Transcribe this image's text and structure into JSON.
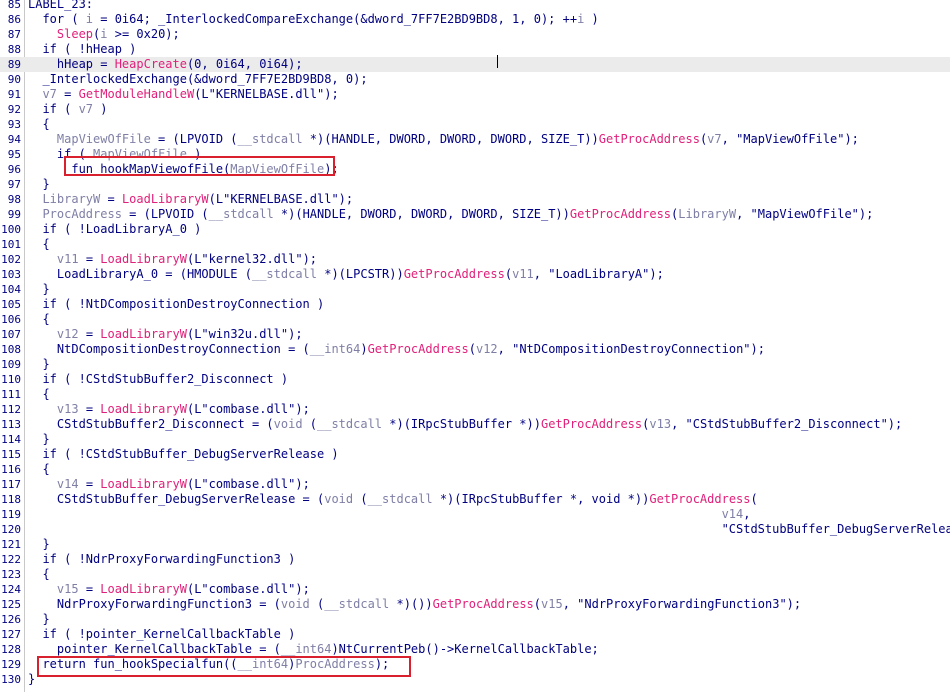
{
  "editor": {
    "lines": [
      {
        "n": "85",
        "parts": [
          {
            "t": "LABEL_23:"
          }
        ]
      },
      {
        "n": "86",
        "parts": [
          {
            "t": "  for ( "
          },
          {
            "t": "i",
            "c": "gr"
          },
          {
            "t": " = 0i64; _InterlockedCompareExchange(&dword_7FF7E2BD9BD8, 1, 0); ++"
          },
          {
            "t": "i",
            "c": "gr"
          },
          {
            "t": " )"
          }
        ]
      },
      {
        "n": "87",
        "parts": [
          {
            "t": "    "
          },
          {
            "t": "Sleep",
            "c": "pk"
          },
          {
            "t": "("
          },
          {
            "t": "i",
            "c": "gr"
          },
          {
            "t": " >= 0x20);"
          }
        ]
      },
      {
        "n": "88",
        "parts": [
          {
            "t": "  if ( !hHeap )"
          }
        ]
      },
      {
        "n": "89",
        "hl": true,
        "parts": [
          {
            "t": "    hHeap = "
          },
          {
            "t": "HeapCreate",
            "c": "pk"
          },
          {
            "t": "(0, 0i64, 0i64);"
          }
        ]
      },
      {
        "n": "90",
        "parts": [
          {
            "t": "  _InterlockedExchange(&dword_7FF7E2BD9BD8, 0);"
          }
        ]
      },
      {
        "n": "91",
        "parts": [
          {
            "t": "  "
          },
          {
            "t": "v7",
            "c": "gr"
          },
          {
            "t": " = "
          },
          {
            "t": "GetModuleHandleW",
            "c": "pk"
          },
          {
            "t": "(L\"KERNELBASE.dll\");"
          }
        ]
      },
      {
        "n": "92",
        "parts": [
          {
            "t": "  if ( "
          },
          {
            "t": "v7",
            "c": "gr"
          },
          {
            "t": " )"
          }
        ]
      },
      {
        "n": "93",
        "parts": [
          {
            "t": "  {"
          }
        ]
      },
      {
        "n": "94",
        "parts": [
          {
            "t": "    "
          },
          {
            "t": "MapViewOfFile",
            "c": "gr"
          },
          {
            "t": " = (LPVOID ("
          },
          {
            "t": "__stdcall",
            "c": "gr"
          },
          {
            "t": " *)(HANDLE, DWORD, DWORD, DWORD, SIZE_T))"
          },
          {
            "t": "GetProcAddress",
            "c": "pk"
          },
          {
            "t": "("
          },
          {
            "t": "v7",
            "c": "gr"
          },
          {
            "t": ", \"MapViewOfFile\");"
          }
        ]
      },
      {
        "n": "95",
        "parts": [
          {
            "t": "    if ( "
          },
          {
            "t": "MapViewOfFile",
            "c": "gr"
          },
          {
            "t": " )"
          }
        ]
      },
      {
        "n": "96",
        "parts": [
          {
            "t": "      fun_hookMapViewofFile("
          },
          {
            "t": "MapViewOfFile",
            "c": "gr"
          },
          {
            "t": ");"
          }
        ]
      },
      {
        "n": "97",
        "parts": [
          {
            "t": "  }"
          }
        ]
      },
      {
        "n": "98",
        "parts": [
          {
            "t": "  "
          },
          {
            "t": "LibraryW",
            "c": "gr"
          },
          {
            "t": " = "
          },
          {
            "t": "LoadLibraryW",
            "c": "pk"
          },
          {
            "t": "(L\"KERNELBASE.dll\");"
          }
        ]
      },
      {
        "n": "99",
        "parts": [
          {
            "t": "  "
          },
          {
            "t": "ProcAddress",
            "c": "gr"
          },
          {
            "t": " = (LPVOID ("
          },
          {
            "t": "__stdcall",
            "c": "gr"
          },
          {
            "t": " *)(HANDLE, DWORD, DWORD, DWORD, SIZE_T))"
          },
          {
            "t": "GetProcAddress",
            "c": "pk"
          },
          {
            "t": "("
          },
          {
            "t": "LibraryW",
            "c": "gr"
          },
          {
            "t": ", \"MapViewOfFile\");"
          }
        ]
      },
      {
        "n": "100",
        "parts": [
          {
            "t": "  if ( !LoadLibraryA_0 )"
          }
        ]
      },
      {
        "n": "101",
        "parts": [
          {
            "t": "  {"
          }
        ]
      },
      {
        "n": "102",
        "parts": [
          {
            "t": "    "
          },
          {
            "t": "v11",
            "c": "gr"
          },
          {
            "t": " = "
          },
          {
            "t": "LoadLibraryW",
            "c": "pk"
          },
          {
            "t": "(L\"kernel32.dll\");"
          }
        ]
      },
      {
        "n": "103",
        "parts": [
          {
            "t": "    LoadLibraryA_0 = (HMODULE ("
          },
          {
            "t": "__stdcall",
            "c": "gr"
          },
          {
            "t": " *)(LPCSTR))"
          },
          {
            "t": "GetProcAddress",
            "c": "pk"
          },
          {
            "t": "("
          },
          {
            "t": "v11",
            "c": "gr"
          },
          {
            "t": ", \"LoadLibraryA\");"
          }
        ]
      },
      {
        "n": "104",
        "parts": [
          {
            "t": "  }"
          }
        ]
      },
      {
        "n": "105",
        "parts": [
          {
            "t": "  if ( !NtDCompositionDestroyConnection )"
          }
        ]
      },
      {
        "n": "106",
        "parts": [
          {
            "t": "  {"
          }
        ]
      },
      {
        "n": "107",
        "parts": [
          {
            "t": "    "
          },
          {
            "t": "v12",
            "c": "gr"
          },
          {
            "t": " = "
          },
          {
            "t": "LoadLibraryW",
            "c": "pk"
          },
          {
            "t": "(L\"win32u.dll\");"
          }
        ]
      },
      {
        "n": "108",
        "parts": [
          {
            "t": "    NtDCompositionDestroyConnection = ("
          },
          {
            "t": "__int64",
            "c": "gr"
          },
          {
            "t": ")"
          },
          {
            "t": "GetProcAddress",
            "c": "pk"
          },
          {
            "t": "("
          },
          {
            "t": "v12",
            "c": "gr"
          },
          {
            "t": ", \"NtDCompositionDestroyConnection\");"
          }
        ]
      },
      {
        "n": "109",
        "parts": [
          {
            "t": "  }"
          }
        ]
      },
      {
        "n": "110",
        "parts": [
          {
            "t": "  if ( !CStdStubBuffer2_Disconnect )"
          }
        ]
      },
      {
        "n": "111",
        "parts": [
          {
            "t": "  {"
          }
        ]
      },
      {
        "n": "112",
        "parts": [
          {
            "t": "    "
          },
          {
            "t": "v13",
            "c": "gr"
          },
          {
            "t": " = "
          },
          {
            "t": "LoadLibraryW",
            "c": "pk"
          },
          {
            "t": "(L\"combase.dll\");"
          }
        ]
      },
      {
        "n": "113",
        "parts": [
          {
            "t": "    CStdStubBuffer2_Disconnect = ("
          },
          {
            "t": "void",
            "c": "gr"
          },
          {
            "t": " ("
          },
          {
            "t": "__stdcall",
            "c": "gr"
          },
          {
            "t": " *)(IRpcStubBuffer *))"
          },
          {
            "t": "GetProcAddress",
            "c": "pk"
          },
          {
            "t": "("
          },
          {
            "t": "v13",
            "c": "gr"
          },
          {
            "t": ", \"CStdStubBuffer2_Disconnect\");"
          }
        ]
      },
      {
        "n": "114",
        "parts": [
          {
            "t": "  }"
          }
        ]
      },
      {
        "n": "115",
        "parts": [
          {
            "t": "  if ( !CStdStubBuffer_DebugServerRelease )"
          }
        ]
      },
      {
        "n": "116",
        "parts": [
          {
            "t": "  {"
          }
        ]
      },
      {
        "n": "117",
        "parts": [
          {
            "t": "    "
          },
          {
            "t": "v14",
            "c": "gr"
          },
          {
            "t": " = "
          },
          {
            "t": "LoadLibraryW",
            "c": "pk"
          },
          {
            "t": "(L\"combase.dll\");"
          }
        ]
      },
      {
        "n": "118",
        "parts": [
          {
            "t": "    CStdStubBuffer_DebugServerRelease = ("
          },
          {
            "t": "void",
            "c": "gr"
          },
          {
            "t": " ("
          },
          {
            "t": "__stdcall",
            "c": "gr"
          },
          {
            "t": " *)(IRpcStubBuffer *, void *))"
          },
          {
            "t": "GetProcAddress",
            "c": "pk"
          },
          {
            "t": "("
          }
        ]
      },
      {
        "n": "119",
        "parts": [
          {
            "t": "                                                                                                "
          },
          {
            "t": "v14",
            "c": "gr"
          },
          {
            "t": ","
          }
        ]
      },
      {
        "n": "120",
        "parts": [
          {
            "t": "                                                                                                \"CStdStubBuffer_DebugServerRelease\");"
          }
        ]
      },
      {
        "n": "121",
        "parts": [
          {
            "t": "  }"
          }
        ]
      },
      {
        "n": "122",
        "parts": [
          {
            "t": "  if ( !NdrProxyForwardingFunction3 )"
          }
        ]
      },
      {
        "n": "123",
        "parts": [
          {
            "t": "  {"
          }
        ]
      },
      {
        "n": "124",
        "parts": [
          {
            "t": "    "
          },
          {
            "t": "v15",
            "c": "gr"
          },
          {
            "t": " = "
          },
          {
            "t": "LoadLibraryW",
            "c": "pk"
          },
          {
            "t": "(L\"combase.dll\");"
          }
        ]
      },
      {
        "n": "125",
        "parts": [
          {
            "t": "    NdrProxyForwardingFunction3 = ("
          },
          {
            "t": "void",
            "c": "gr"
          },
          {
            "t": " ("
          },
          {
            "t": "__stdcall",
            "c": "gr"
          },
          {
            "t": " *)())"
          },
          {
            "t": "GetProcAddress",
            "c": "pk"
          },
          {
            "t": "("
          },
          {
            "t": "v15",
            "c": "gr"
          },
          {
            "t": ", \"NdrProxyForwardingFunction3\");"
          }
        ]
      },
      {
        "n": "126",
        "parts": [
          {
            "t": "  }"
          }
        ]
      },
      {
        "n": "127",
        "parts": [
          {
            "t": "  if ( !pointer_KernelCallbackTable )"
          }
        ]
      },
      {
        "n": "128",
        "parts": [
          {
            "t": "    pointer_KernelCallbackTable = ("
          },
          {
            "t": "__int64",
            "c": "gr"
          },
          {
            "t": ")NtCurrentPeb()->KernelCallbackTable;"
          }
        ]
      },
      {
        "n": "129",
        "parts": [
          {
            "t": "  return fun_hookSpecialfun(("
          },
          {
            "t": "__int64",
            "c": "gr"
          },
          {
            "t": ")"
          },
          {
            "t": "ProcAddress",
            "c": "gr"
          },
          {
            "t": ");"
          }
        ]
      },
      {
        "n": "130",
        "parts": [
          {
            "t": "}"
          }
        ]
      }
    ]
  },
  "highlight_colors": {
    "box": "#d9202f",
    "line_highlight": "#ebebeb",
    "function_call": "#e0207a",
    "variable": "#7f7fa6",
    "text": "#000080"
  }
}
